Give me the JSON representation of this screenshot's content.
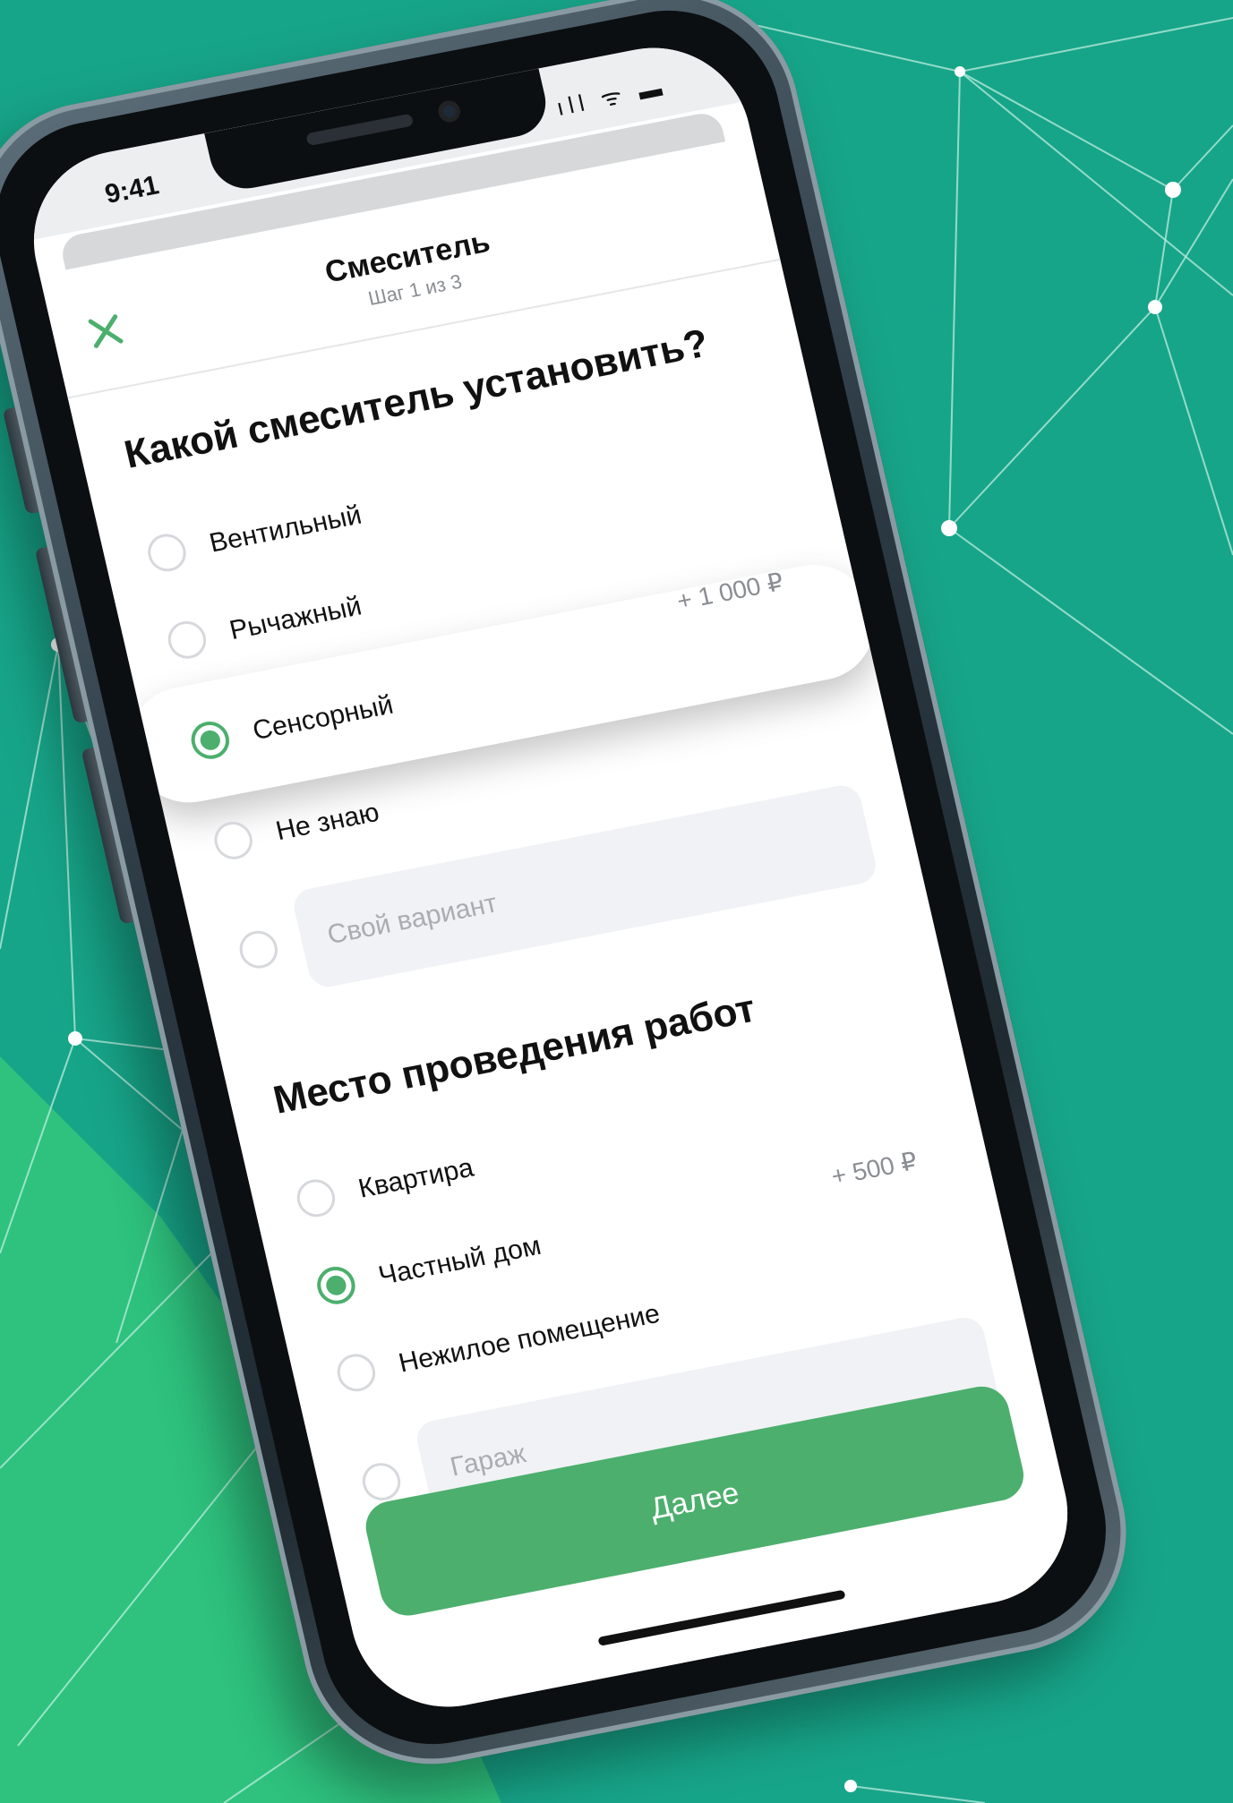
{
  "status_bar": {
    "time": "9:41",
    "icons": "ıll ᯤ ▬"
  },
  "header": {
    "title": "Смеситель",
    "subtitle": "Шаг 1 из 3"
  },
  "section1": {
    "title": "Какой смеситель установить?",
    "options": [
      {
        "label": "Вентильный",
        "checked": false
      },
      {
        "label": "Рычажный",
        "checked": false
      },
      {
        "label": "Сенсорный",
        "checked": true,
        "price": "+ 1 000 ₽"
      },
      {
        "label": "Не знаю",
        "checked": false
      }
    ],
    "custom_placeholder": "Свой вариант"
  },
  "section2": {
    "title": "Место проведения работ",
    "options": [
      {
        "label": "Квартира",
        "checked": false
      },
      {
        "label": "Частный дом",
        "checked": true,
        "price": "+ 500 ₽"
      },
      {
        "label": "Нежилое помещение",
        "checked": false
      }
    ],
    "custom_placeholder": "Гараж"
  },
  "next_button": "Далее",
  "colors": {
    "background": "#17a589",
    "accent": "#4caf6d",
    "light_green": "#2ec27e"
  }
}
